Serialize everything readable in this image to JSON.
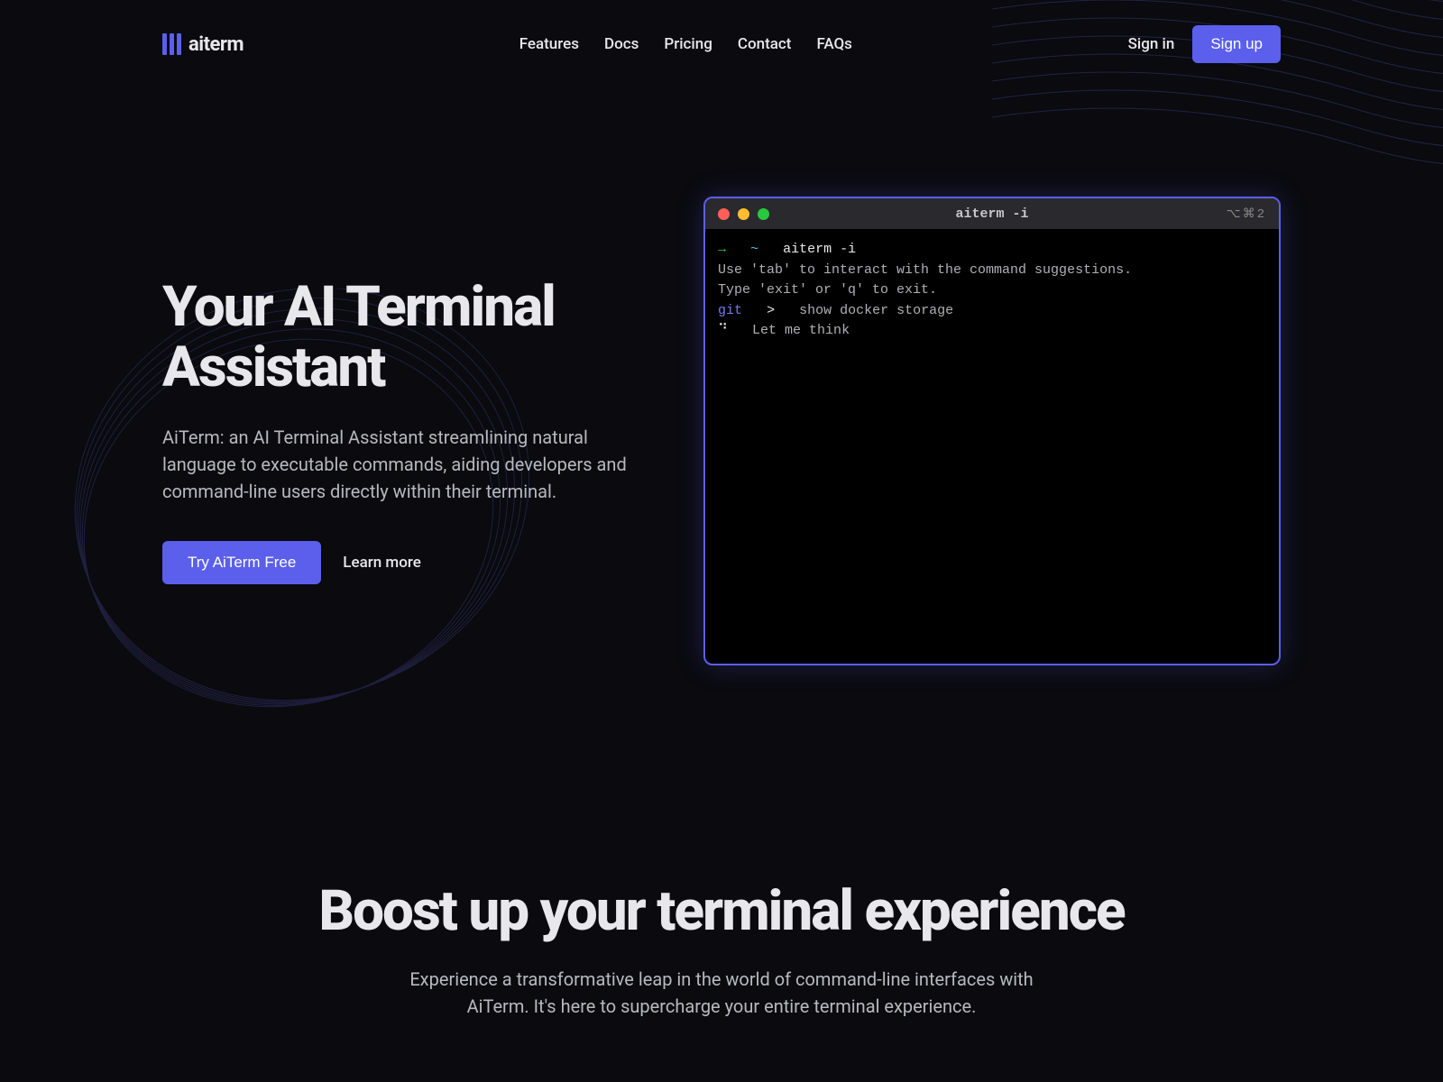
{
  "brand": {
    "name": "aiterm"
  },
  "nav": {
    "items": [
      {
        "label": "Features"
      },
      {
        "label": "Docs"
      },
      {
        "label": "Pricing"
      },
      {
        "label": "Contact"
      },
      {
        "label": "FAQs"
      }
    ]
  },
  "auth": {
    "signin": "Sign in",
    "signup": "Sign up"
  },
  "hero": {
    "title": "Your AI Terminal Assistant",
    "subtitle": "AiTerm: an AI Terminal Assistant streamlining natural language to executable commands, aiding developers and command-line users directly within their terminal.",
    "cta_primary": "Try AiTerm Free",
    "cta_secondary": "Learn more"
  },
  "terminal": {
    "title": "aiterm -i",
    "icons": "⌥⌘2",
    "lines": {
      "l1_arrow": "→",
      "l1_tilde": "~",
      "l1_cmd": "aiterm -i",
      "l2": "Use 'tab' to interact with the command suggestions.",
      "l3": "Type 'exit' or 'q' to exit.",
      "l4_prefix": "git",
      "l4_prompt": ">",
      "l4_text": "show docker storage",
      "l5_spinner": "⠙",
      "l5_text": "Let me think"
    }
  },
  "boost": {
    "title": "Boost up your terminal experience",
    "subtitle": "Experience a transformative leap in the world of command-line interfaces with AiTerm. It's here to supercharge your entire terminal experience."
  },
  "colors": {
    "accent": "#5b5fec",
    "background": "#0a0a0f"
  }
}
